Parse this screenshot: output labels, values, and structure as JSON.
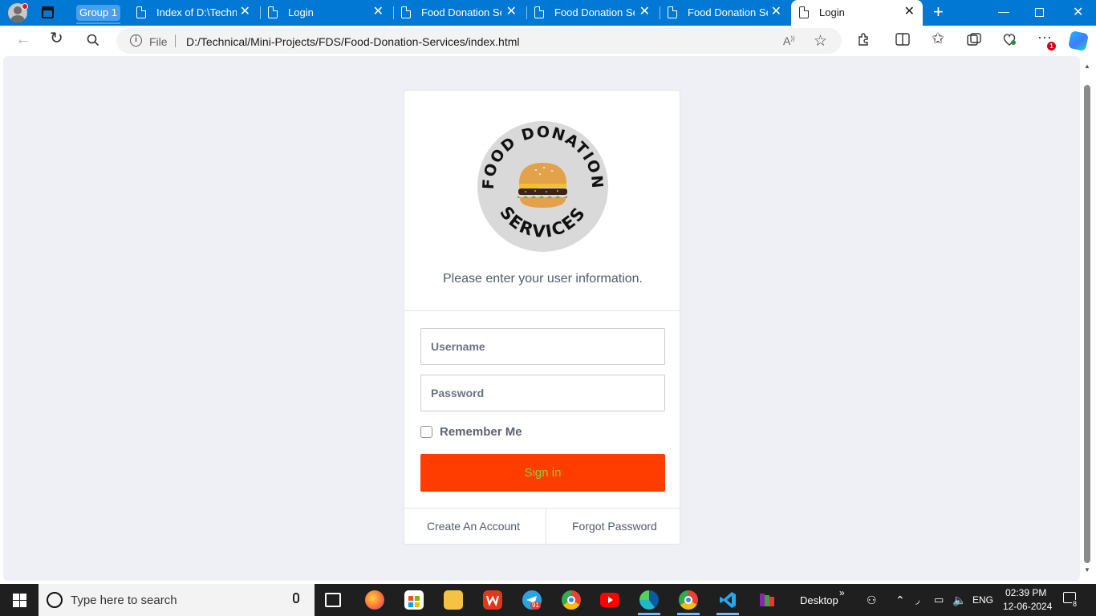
{
  "browser": {
    "group_label": "Group 1",
    "tabs": [
      {
        "label": "Index of D:\\Technic",
        "active": false
      },
      {
        "label": "Login",
        "active": false
      },
      {
        "label": "Food Donation Ser",
        "active": false
      },
      {
        "label": "Food Donation Ser",
        "active": false
      },
      {
        "label": "Food Donation Ser",
        "active": false
      },
      {
        "label": "Login",
        "active": true
      }
    ],
    "address": {
      "scheme_label": "File",
      "url": "D:/Technical/Mini-Projects/FDS/Food-Donation-Services/index.html"
    },
    "extensions_badge": "1"
  },
  "login": {
    "logo": {
      "text_top": "FOOD DONATION",
      "text_bottom": "SERVICES",
      "emblem": "burger-icon"
    },
    "prompt": "Please enter your user information.",
    "username_placeholder": "Username",
    "password_placeholder": "Password",
    "remember_label": "Remember Me",
    "remember_checked": false,
    "signin_label": "Sign in",
    "create_account_label": "Create An Account",
    "forgot_password_label": "Forgot Password",
    "colors": {
      "signin_bg": "#ff3d00",
      "signin_text": "#9bc53d",
      "page_bg": "#eef0f5"
    }
  },
  "taskbar": {
    "search_placeholder": "Type here to search",
    "desktop_label": "Desktop",
    "language": "ENG",
    "time": "02:39 PM",
    "date": "12-06-2024",
    "notification_count": "8",
    "telegram_badge": "91"
  }
}
